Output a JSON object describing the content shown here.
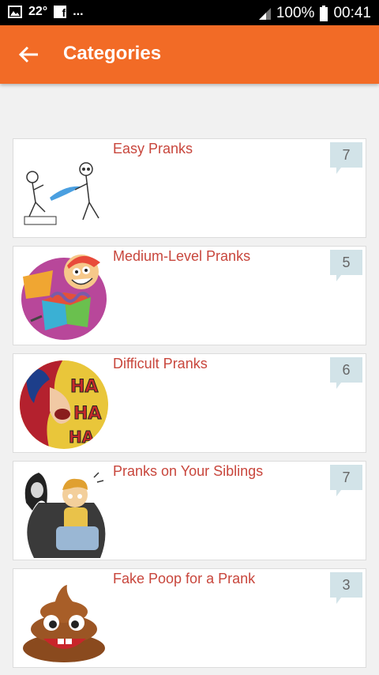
{
  "status_bar": {
    "temperature": "22°",
    "more": "...",
    "battery": "100%",
    "time": "00:41"
  },
  "toolbar": {
    "title": "Categories"
  },
  "categories": [
    {
      "title": "Easy Pranks",
      "count": "7"
    },
    {
      "title": "Medium-Level Pranks",
      "count": "5"
    },
    {
      "title": "Difficult Pranks",
      "count": "6"
    },
    {
      "title": "Pranks on Your Siblings",
      "count": "7"
    },
    {
      "title": "Fake Poop for a Prank",
      "count": "3"
    }
  ],
  "icons": [
    "image-icon",
    "facebook-icon",
    "signal-icon",
    "battery-icon",
    "back-arrow-icon"
  ],
  "colors": {
    "toolbar": "#f26b26",
    "title_text": "#c8463c",
    "badge": "#d2e3e8"
  }
}
